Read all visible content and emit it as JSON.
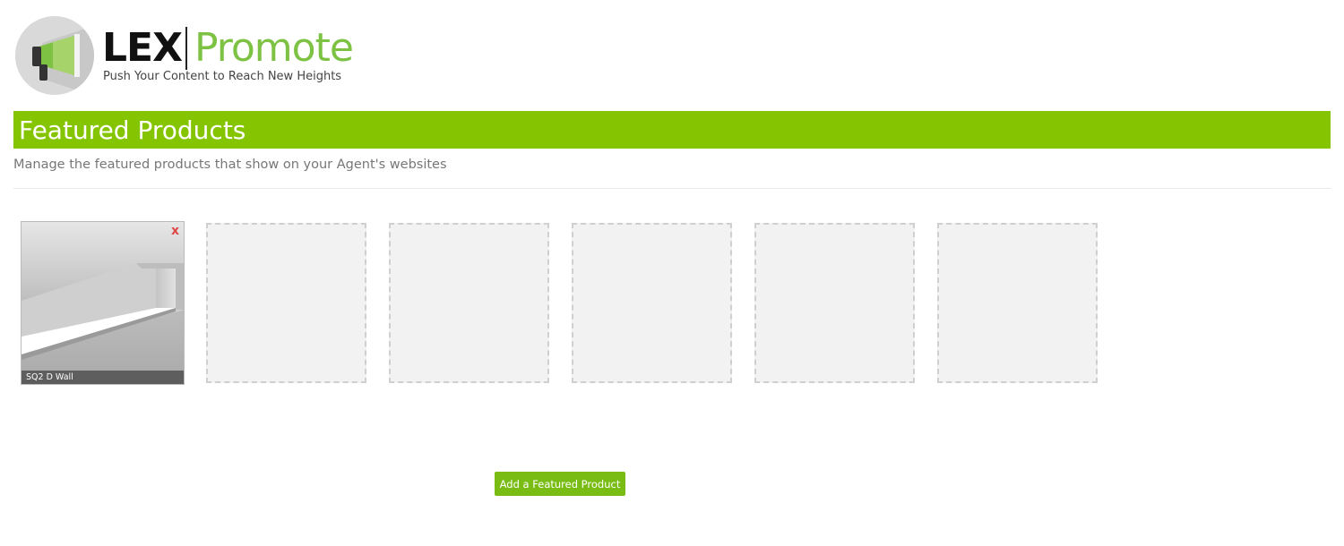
{
  "brand": {
    "name": "LEX",
    "product": "Promote",
    "tagline": "Push Your Content to Reach New Heights",
    "logo_icon": "megaphone-icon",
    "accent_color": "#85c400"
  },
  "header": {
    "title": "Featured Products",
    "subtitle": "Manage the featured products that show on your Agent's websites"
  },
  "featured_products": [
    {
      "label": "SQ2 D Wall",
      "remove_label": "x",
      "image": "linear-light-fixture"
    }
  ],
  "empty_slots": 5,
  "actions": {
    "add_label": "Add a Featured Product"
  }
}
